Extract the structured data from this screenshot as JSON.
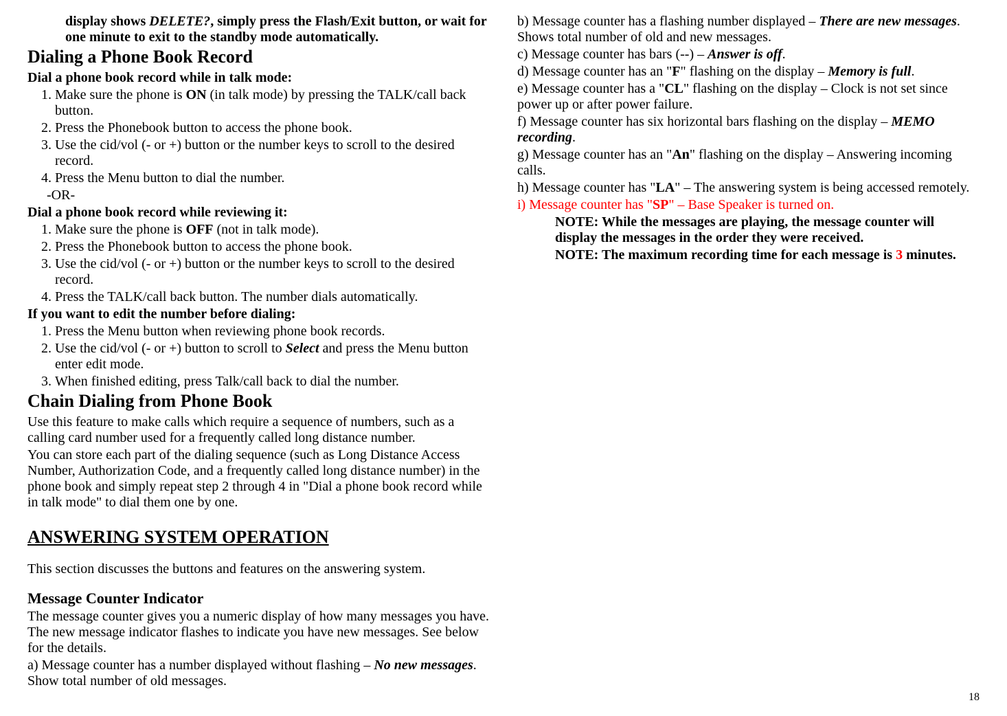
{
  "continuation": {
    "l1a": "display shows ",
    "l1b": "DELETE?",
    "l1c": ", simply press the Flash/Exit button, or wait for one minute to exit to the standby mode automatically."
  },
  "dialing": {
    "heading": "Dialing a Phone Book Record",
    "sub1": "Dial a phone book record while in talk mode:",
    "item1a": "Make sure the phone is ",
    "item1b": "ON",
    "item1c": " (in talk mode) by pressing the TALK/call back button.",
    "item2": "Press the Phonebook button to access the phone book.",
    "item3": "Use the cid/vol (- or +) button or the number keys to scroll to the desired record.",
    "item4": "Press the Menu button to dial the number.",
    "or": "-OR-",
    "sub2": "Dial a phone book record while reviewing it:",
    "b_item1a": "Make sure the phone is ",
    "b_item1b": "OFF",
    "b_item1c": " (not in talk mode).",
    "b_item2": "Press the Phonebook button to access the phone book.",
    "b_item3": "Use the cid/vol (- or +) button or the number keys to scroll to the desired record.",
    "b_item4": "Press the TALK/call back button. The number dials automatically.",
    "sub3": "If you want to edit the number before dialing:",
    "c_item1": "Press the Menu button when reviewing phone book records.",
    "c_item2a": "Use the cid/vol (- or +) button to scroll to ",
    "c_item2b": "Select",
    "c_item2c": " and press the Menu button enter edit mode.",
    "c_item3": "When finished editing, press Talk/call back to dial the number."
  },
  "chain": {
    "heading": "Chain Dialing from Phone Book",
    "p1": "Use this feature to make calls which require a sequence of numbers, such as a calling card number used for a frequently called long distance number.",
    "p2": "You can store each part of the dialing sequence (such as Long Distance Access Number, Authorization Code, and a frequently called long distance number) in the phone book and simply repeat step 2 through 4 in \"Dial a phone book record while in talk mode\" to dial them one by one."
  },
  "answer": {
    "heading": "ANSWERING SYSTEM OPERATION",
    "intro": "This section discusses the buttons and features on the answering system."
  },
  "counter": {
    "heading": "Message Counter Indicator",
    "p1": "The message counter gives you a numeric display of how many messages you have. The new message indicator flashes to indicate you have new messages. See below for the details.",
    "a1": "a) Message counter has a number displayed without flashing – ",
    "a2": "No new messages",
    "a3": ". Show total number of old messages.",
    "b1": "b) Message counter has a flashing number displayed – ",
    "b2": "There are new messages",
    "b3": ". Shows total number of old and new messages.",
    "c1": "c) Message counter has bars (--) – ",
    "c2": "Answer is off",
    "c3": ".",
    "d1": "d) Message counter has an \"",
    "d2": "F",
    "d3": "\" flashing on the display – ",
    "d4": "Memory is full",
    "d5": ".",
    "e1": "e) Message counter has a \"",
    "e2": "CL",
    "e3": "\" flashing on the display – Clock is not set since power up or after power failure.",
    "f1": "f) Message counter has six horizontal bars flashing on the display – ",
    "f2": "MEMO recording",
    "f3": ".",
    "g1": "g) Message counter has an \"",
    "g2": "An",
    "g3": "\" flashing on the display – Answering incoming calls.",
    "h1": "h) Message counter has \"",
    "h2": "LA",
    "h3": "\" – The answering system is being accessed remotely.",
    "i1": "i) Message counter has \"",
    "i2": "SP",
    "i3": "\" – Base Speaker is turned on.",
    "note1": "NOTE: While the messages are playing, the message counter will display the messages in the order they were received.",
    "note2a": "NOTE: The maximum recording time for each message is ",
    "note2b": "3",
    "note2c": " minutes."
  },
  "page_num": "18"
}
